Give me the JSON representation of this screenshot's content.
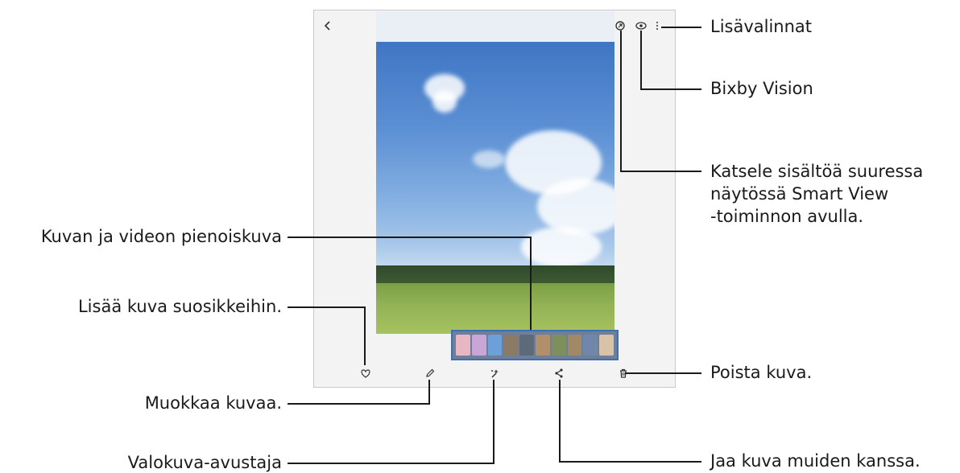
{
  "callouts": {
    "more_options": "Lisävalinnat",
    "bixby_vision": "Bixby Vision",
    "smart_view_line1": "Katsele sisältöä suuressa",
    "smart_view_line2": "näytössä Smart View",
    "smart_view_line3": "-toiminnon avulla.",
    "thumbnails": "Kuvan ja videon pienoiskuva",
    "favorite": "Lisää kuva suosikkeihin.",
    "delete": "Poista kuva.",
    "edit": "Muokkaa kuvaa.",
    "share": "Jaa kuva muiden kanssa.",
    "photo_assist": "Valokuva-avustaja"
  },
  "icons": {
    "back": "chevron-left-icon",
    "smart_view": "smart-view-icon",
    "bixby": "eye-icon",
    "more": "more-vertical-icon",
    "favorite": "heart-icon",
    "edit": "pencil-icon",
    "assist": "sparkle-icon",
    "share": "share-icon",
    "delete": "trash-icon"
  },
  "thumbnail_colors": [
    "#e8b7c4",
    "#c9a6d6",
    "#6d9fd8",
    "#8a7a66",
    "#5d6a7a",
    "#b08f6a",
    "#7c8f5c",
    "#a28864",
    "#6f87a8",
    "#d8c3a8"
  ]
}
